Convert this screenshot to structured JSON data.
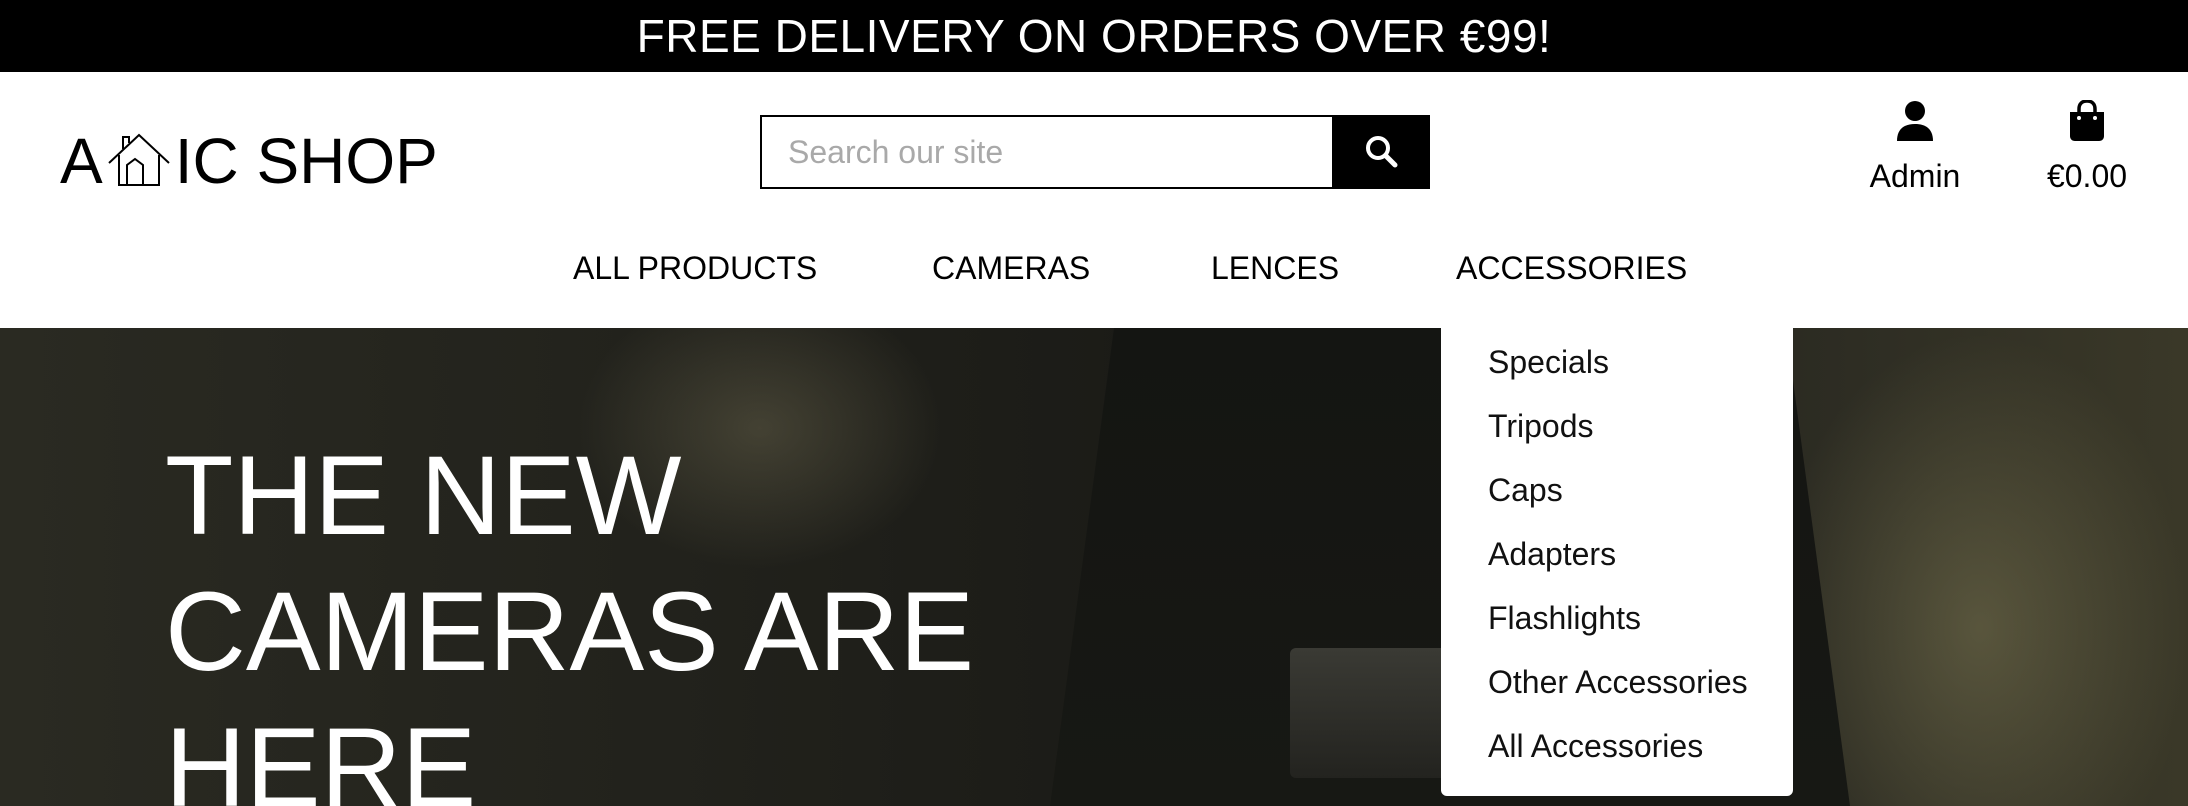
{
  "banner": {
    "text": "FREE DELIVERY ON ORDERS OVER €99!"
  },
  "logo": {
    "left_text": "A",
    "right_text": "IC SHOP",
    "icon": "house-icon"
  },
  "search": {
    "placeholder": "Search our site",
    "value": "",
    "icon": "search-icon"
  },
  "account": {
    "label": "Admin",
    "icon": "user-icon"
  },
  "cart": {
    "total": "€0.00",
    "icon": "shopping-bag-icon"
  },
  "nav": {
    "items": [
      {
        "label": "ALL PRODUCTS"
      },
      {
        "label": "CAMERAS"
      },
      {
        "label": "LENCES"
      },
      {
        "label": "ACCESSORIES"
      }
    ]
  },
  "accessories_menu": {
    "items": [
      {
        "label": "Specials"
      },
      {
        "label": "Tripods"
      },
      {
        "label": "Caps"
      },
      {
        "label": "Adapters"
      },
      {
        "label": "Flashlights"
      },
      {
        "label": "Other Accessories"
      },
      {
        "label": "All Accessories"
      }
    ]
  },
  "hero": {
    "headline": "THE NEW CAMERAS ARE HERE"
  },
  "colors": {
    "banner_bg": "#000000",
    "search_button_bg": "#000000",
    "hero_text": "#ffffff"
  }
}
